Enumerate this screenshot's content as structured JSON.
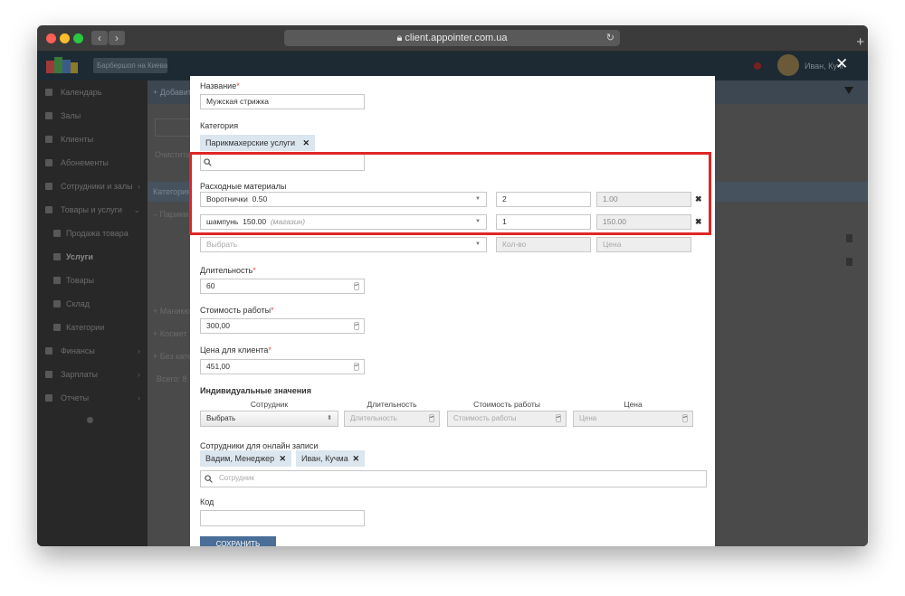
{
  "browser": {
    "url": "client.appointer.com.ua"
  },
  "app": {
    "branch": "Барбершоп на Киева",
    "user": "Иван, Кучма"
  },
  "sidebar": {
    "items": [
      {
        "label": "Календарь",
        "sub": false
      },
      {
        "label": "Залы",
        "sub": false
      },
      {
        "label": "Клиенты",
        "sub": false
      },
      {
        "label": "Абонементы",
        "sub": false
      },
      {
        "label": "Сотрудники и залы",
        "sub": false,
        "chev": "›"
      },
      {
        "label": "Товары и услуги",
        "sub": false,
        "chev": "⌄"
      },
      {
        "label": "Продажа товара",
        "sub": true
      },
      {
        "label": "Услуги",
        "sub": true,
        "active": true
      },
      {
        "label": "Товары",
        "sub": true
      },
      {
        "label": "Склад",
        "sub": true
      },
      {
        "label": "Категории",
        "sub": true
      },
      {
        "label": "Финансы",
        "sub": false,
        "chev": "›"
      },
      {
        "label": "Зарплаты",
        "sub": false,
        "chev": "›"
      },
      {
        "label": "Отчеты",
        "sub": false,
        "chev": "›"
      }
    ]
  },
  "background": {
    "add_button": "Добавить",
    "clear": "Очистить",
    "category_header": "Категория",
    "rows": [
      "Парикм",
      "Маникю",
      "Космет",
      "Без кате"
    ],
    "total": "Всего: 8"
  },
  "form": {
    "name_label": "Название",
    "name_value": "Мужская стрижка",
    "category_label": "Категория",
    "category_tag": "Парикмахерские услуги",
    "materials_label": "Расходные материалы",
    "materials": [
      {
        "name": "Воротнички",
        "price": "0.50",
        "store": "",
        "qty": "2",
        "cost": "1.00"
      },
      {
        "name": "шампунь",
        "price": "150.00",
        "store": "(магазин)",
        "qty": "1",
        "cost": "150.00"
      }
    ],
    "material_new": {
      "select_placeholder": "Выбрать",
      "qty_placeholder": "Кол-во",
      "cost_placeholder": "Цена"
    },
    "duration_label": "Длительность",
    "duration_value": "60",
    "work_cost_label": "Стоимость работы",
    "work_cost_value": "300,00",
    "client_price_label": "Цена для клиента",
    "client_price_value": "451,00",
    "individual_title": "Индивидуальные значения",
    "individual_headers": [
      "Сотрудник",
      "Длительность",
      "Стоимость работы",
      "Цена"
    ],
    "individual_row": {
      "employee": "Выбрать",
      "duration": "Длительность",
      "cost": "Стоимость работы",
      "price": "Цена"
    },
    "online_label": "Сотрудники для онлайн записи",
    "online_tags": [
      "Вадим, Менеджер",
      "Иван, Кучма"
    ],
    "employee_search_placeholder": "Сотрудник",
    "code_label": "Код",
    "code_value": "",
    "save_button": "СОХРАНИТЬ"
  },
  "icons": {
    "remove": "remove-x-icon",
    "search": "search-icon",
    "close": "close-icon"
  },
  "colors": {
    "highlight": "#e02626",
    "primary": "#4a6e97",
    "tag": "#dce6ef"
  }
}
